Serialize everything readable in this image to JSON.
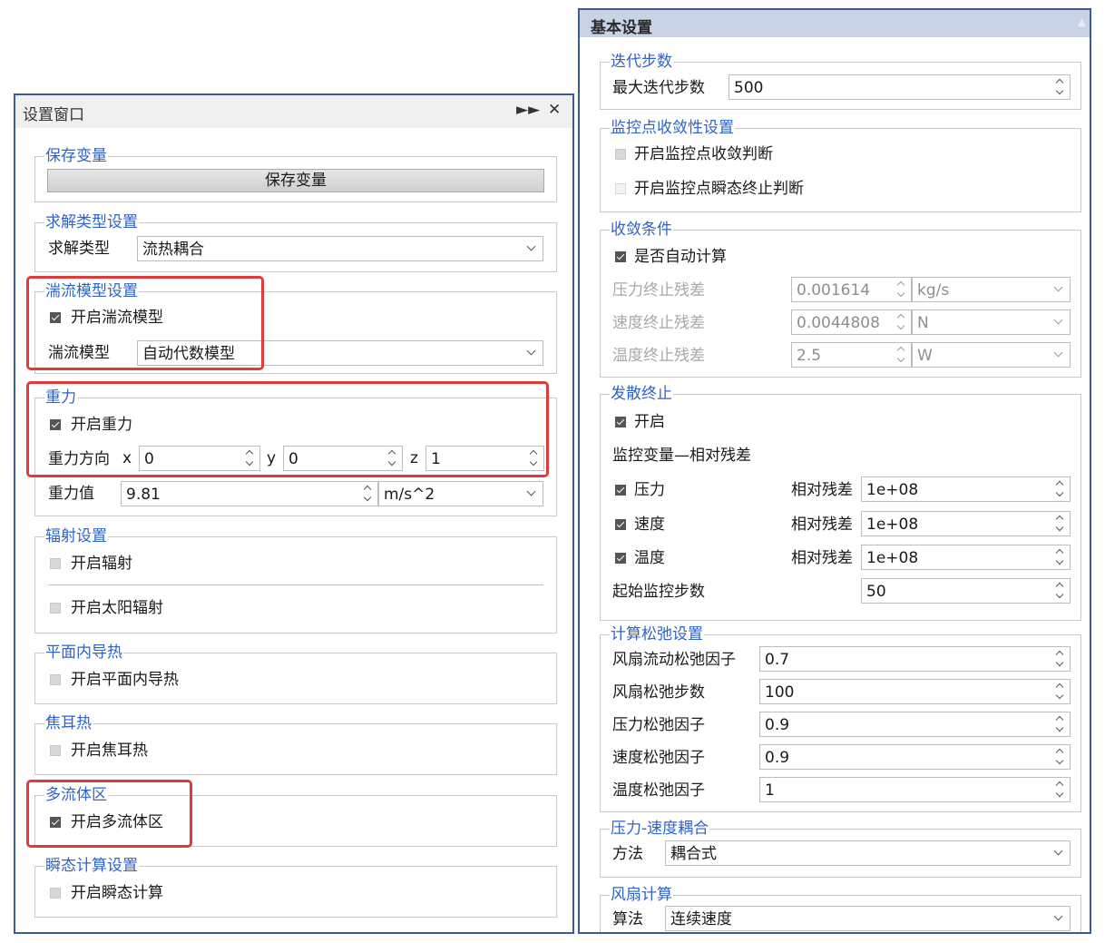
{
  "left": {
    "title": "设置窗口",
    "save_group": {
      "legend": "保存变量",
      "button": "保存变量"
    },
    "solve_group": {
      "legend": "求解类型设置",
      "label": "求解类型",
      "value": "流热耦合"
    },
    "turb_group": {
      "legend": "湍流模型设置",
      "check": "开启湍流模型",
      "check_on": true,
      "label": "湍流模型",
      "value": "自动代数模型"
    },
    "gravity_group": {
      "legend": "重力",
      "check": "开启重力",
      "check_on": true,
      "dir_label": "重力方向",
      "x_label": "x",
      "x": "0",
      "y_label": "y",
      "y": "0",
      "z_label": "z",
      "z": "1",
      "val_label": "重力值",
      "val": "9.81",
      "unit": "m/s^2"
    },
    "rad_group": {
      "legend": "辐射设置",
      "check1": "开启辐射",
      "check2": "开启太阳辐射"
    },
    "plane_group": {
      "legend": "平面内导热",
      "check": "开启平面内导热"
    },
    "joule_group": {
      "legend": "焦耳热",
      "check": "开启焦耳热"
    },
    "multi_group": {
      "legend": "多流体区",
      "check": "开启多流体区",
      "check_on": true
    },
    "transient_group": {
      "legend": "瞬态计算设置",
      "check": "开启瞬态计算"
    }
  },
  "right": {
    "title": "基本设置",
    "iter_group": {
      "legend": "迭代步数",
      "label": "最大迭代步数",
      "value": "500"
    },
    "monitor_group": {
      "legend": "监控点收敛性设置",
      "check1": "开启监控点收敛判断",
      "check2": "开启监控点瞬态终止判断"
    },
    "conv_group": {
      "legend": "收敛条件",
      "check": "是否自动计算",
      "rows": [
        {
          "label": "压力终止残差",
          "value": "0.001614",
          "unit": "kg/s"
        },
        {
          "label": "速度终止残差",
          "value": "0.0044808",
          "unit": "N"
        },
        {
          "label": "温度终止残差",
          "value": "2.5",
          "unit": "W"
        }
      ]
    },
    "div_group": {
      "legend": "发散终止",
      "check": "开启",
      "subtitle": "监控变量—相对残差",
      "rows": [
        {
          "label": "压力",
          "rel_label": "相对残差",
          "value": "1e+08"
        },
        {
          "label": "速度",
          "rel_label": "相对残差",
          "value": "1e+08"
        },
        {
          "label": "温度",
          "rel_label": "相对残差",
          "value": "1e+08"
        }
      ],
      "start_label": "起始监控步数",
      "start_value": "50"
    },
    "relax_group": {
      "legend": "计算松弛设置",
      "rows": [
        {
          "label": "风扇流动松弛因子",
          "value": "0.7"
        },
        {
          "label": "风扇松弛步数",
          "value": "100"
        },
        {
          "label": "压力松弛因子",
          "value": "0.9"
        },
        {
          "label": "速度松弛因子",
          "value": "0.9"
        },
        {
          "label": "温度松弛因子",
          "value": "1"
        }
      ]
    },
    "coupling_group": {
      "legend": "压力-速度耦合",
      "label": "方法",
      "value": "耦合式"
    },
    "fan_group": {
      "legend": "风扇计算",
      "label": "算法",
      "value": "连续速度"
    }
  },
  "colors": {
    "accent": "#2f63c9",
    "panel_border": "#3c5a9a",
    "highlight": "#e03a3a",
    "header": "#c8d3e6"
  },
  "icons": {
    "expand": "double-chevron-right-icon",
    "close": "close-icon"
  }
}
